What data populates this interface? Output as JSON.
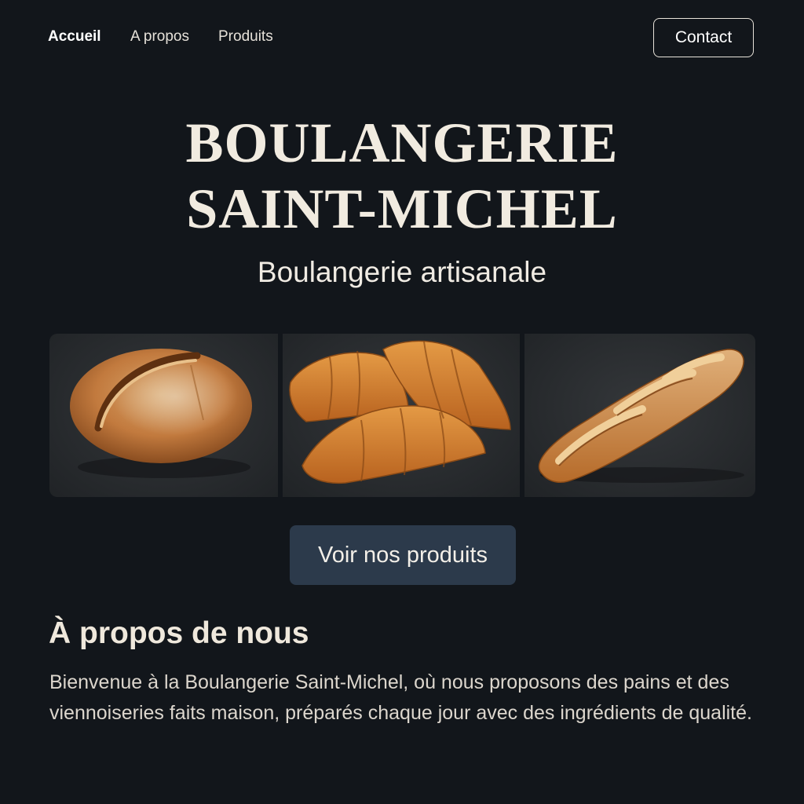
{
  "nav": {
    "links": [
      {
        "label": "Accueil"
      },
      {
        "label": "A propos"
      },
      {
        "label": "Produits"
      }
    ],
    "contact_label": "Contact"
  },
  "hero": {
    "title_line1": "BOULANGERIE",
    "title_line2": "SAINT-MICHEL",
    "tagline": "Boulangerie artisanale"
  },
  "gallery": {
    "images": [
      "round-country-loaf-image",
      "croissants-image",
      "baguette-image"
    ]
  },
  "cta": {
    "label": "Voir nos produits"
  },
  "about": {
    "title": "À propos de nous",
    "text": "Bienvenue à la Boulangerie Saint-Michel, où nous proposons des pains et des viennoiseries faits maison, préparés chaque jour avec des ingrédients de qualité."
  },
  "colors": {
    "background": "#12161b",
    "cta_background": "#2c3a4b",
    "text_light": "#ece6dc"
  }
}
